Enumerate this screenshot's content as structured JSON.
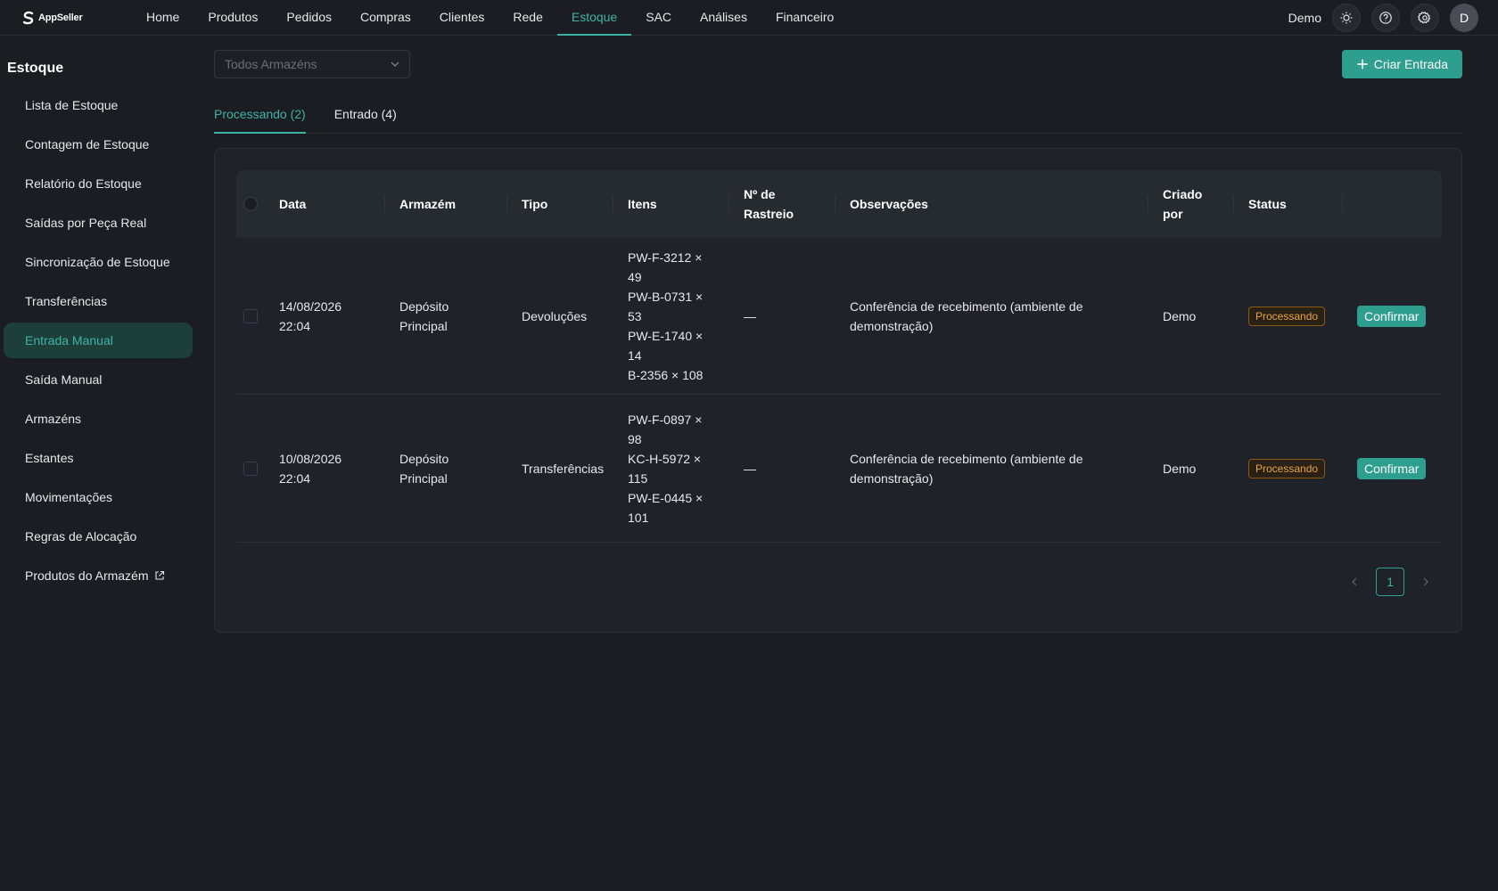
{
  "brand": {
    "name": "AppSeller"
  },
  "nav": {
    "items": [
      "Home",
      "Produtos",
      "Pedidos",
      "Compras",
      "Clientes",
      "Rede",
      "Estoque",
      "SAC",
      "Análises",
      "Financeiro"
    ],
    "active": "Estoque"
  },
  "user": {
    "name": "Demo",
    "avatar_initial": "D"
  },
  "icons": {
    "theme": "sun-icon",
    "help": "question-circle-icon",
    "settings": "gear-icon"
  },
  "sidebar": {
    "title": "Estoque",
    "items": [
      "Lista de Estoque",
      "Contagem de Estoque",
      "Relatório do Estoque",
      "Saídas por Peça Real",
      "Sincronização de Estoque",
      "Transferências",
      "Entrada Manual",
      "Saída Manual",
      "Armazéns",
      "Estantes",
      "Movimentações",
      "Regras de Alocação",
      "Produtos do Armazém"
    ],
    "active": "Entrada Manual"
  },
  "filter": {
    "warehouse_placeholder": "Todos Armazéns"
  },
  "actions": {
    "create_label": "Criar Entrada"
  },
  "tabs": [
    {
      "label": "Processando (2)",
      "active": true
    },
    {
      "label": "Entrado (4)",
      "active": false
    }
  ],
  "table": {
    "headers": {
      "data": "Data",
      "armazem": "Armazém",
      "tipo": "Tipo",
      "itens": "Itens",
      "rastreio_1": "Nº de",
      "rastreio_2": "Rastreio",
      "observacoes": "Observações",
      "criado_1": "Criado",
      "criado_2": "por",
      "status": "Status"
    },
    "rows": [
      {
        "date": "14/08/2026",
        "time": "22:04",
        "warehouse_1": "Depósito",
        "warehouse_2": "Principal",
        "type": "Devoluções",
        "items": [
          "PW-F-3212 ×",
          "49",
          "PW-B-0731 ×",
          "53",
          "PW-E-1740 ×",
          "14",
          "B-2356 × 108"
        ],
        "tracking": "—",
        "notes_1": "Conferência de recebimento (ambiente de",
        "notes_2": "demonstração)",
        "created_by": "Demo",
        "status": "Processando",
        "action": "Confirmar"
      },
      {
        "date": "10/08/2026",
        "time": "22:04",
        "warehouse_1": "Depósito",
        "warehouse_2": "Principal",
        "type": "Transferências",
        "items": [
          "PW-F-0897 ×",
          "98",
          "KC-H-5972 ×",
          "115",
          "PW-E-0445 ×",
          "101"
        ],
        "tracking": "—",
        "notes_1": "Conferência de recebimento (ambiente de",
        "notes_2": "demonstração)",
        "created_by": "Demo",
        "status": "Processando",
        "action": "Confirmar"
      }
    ]
  },
  "pagination": {
    "current": "1"
  },
  "colors": {
    "accent": "#2e9e8f",
    "accent_text": "#3fb3a3",
    "badge_text": "#e8a33a",
    "background": "#1b1d22"
  }
}
